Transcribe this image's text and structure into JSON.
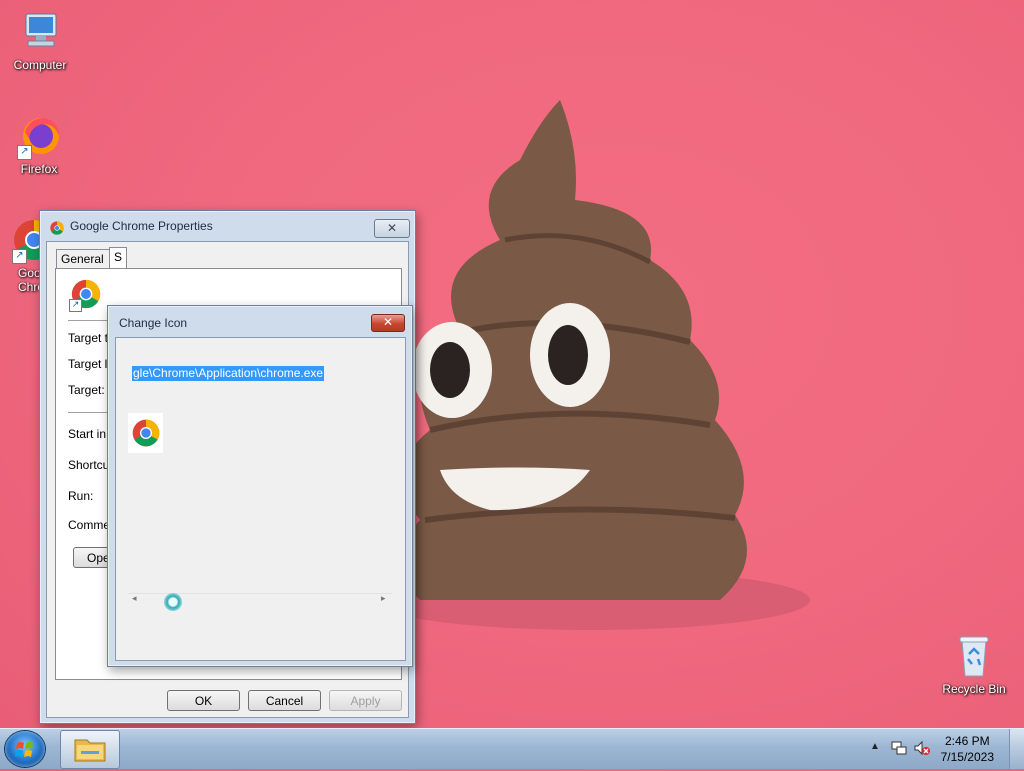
{
  "desktop": {
    "icons": [
      {
        "label": "Computer"
      },
      {
        "label": "Firefox"
      },
      {
        "label": "Google Chrome",
        "label_visible": "Goo Chro"
      },
      {
        "label": "Recycle Bin"
      }
    ]
  },
  "properties_window": {
    "title": "Google Chrome Properties",
    "close_glyph": "✕",
    "tabs": [
      {
        "label": "General"
      },
      {
        "label": "S"
      }
    ],
    "fields": [
      {
        "label": "Target t"
      },
      {
        "label": "Target lo"
      },
      {
        "label": "Target:"
      },
      {
        "label": "Start in:"
      },
      {
        "label": "Shortcut"
      },
      {
        "label": "Run:"
      },
      {
        "label": "Comme"
      }
    ],
    "open_button_label": "Ope",
    "ok_label": "OK",
    "cancel_label": "Cancel",
    "apply_label": "Apply"
  },
  "change_icon_dialog": {
    "title": "Change Icon",
    "close_glyph": "✕",
    "path_value": "gle\\Chrome\\Application\\chrome.exe",
    "scroll_left": "◂",
    "scroll_right": "▸"
  },
  "taskbar": {
    "time": "2:46 PM",
    "date": "7/15/2023",
    "tray_chevron": "▲"
  },
  "colors": {
    "wallpaper": "#f0697f",
    "selection": "#3399ff",
    "taskbar": "#9cb6d3"
  }
}
